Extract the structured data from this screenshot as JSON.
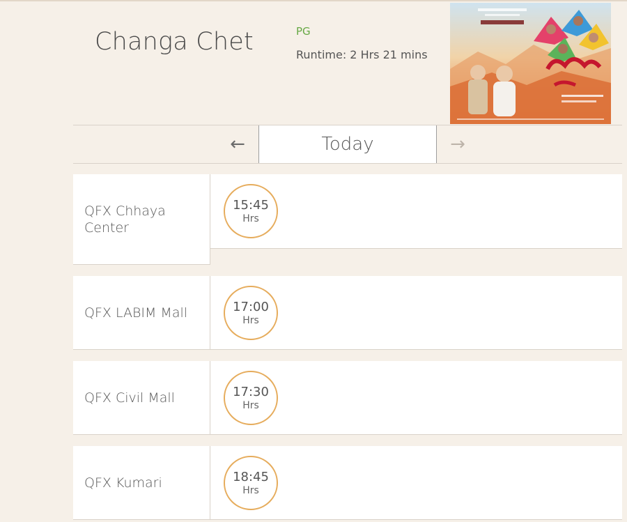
{
  "movie": {
    "title": "Changa Chet",
    "rating": "PG",
    "runtime": "Runtime: 2 Hrs 21 mins"
  },
  "date_nav": {
    "prev_icon": "arrow-left-icon",
    "prev_glyph": "←",
    "current": "Today",
    "next_icon": "arrow-right-icon",
    "next_glyph": "→"
  },
  "cinemas": [
    {
      "name": "QFX Chhaya Center",
      "times": [
        {
          "time": "15:45",
          "unit": "Hrs"
        }
      ]
    },
    {
      "name": "QFX LABIM Mall",
      "times": [
        {
          "time": "17:00",
          "unit": "Hrs"
        }
      ]
    },
    {
      "name": "QFX Civil Mall",
      "times": [
        {
          "time": "17:30",
          "unit": "Hrs"
        }
      ]
    },
    {
      "name": "QFX Kumari",
      "times": [
        {
          "time": "18:45",
          "unit": "Hrs"
        }
      ]
    }
  ],
  "colors": {
    "background": "#f6f0e8",
    "rating": "#66a844",
    "time_ring": "#e6ac5c"
  }
}
